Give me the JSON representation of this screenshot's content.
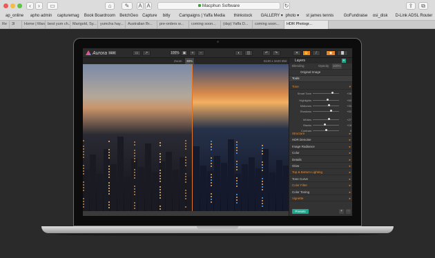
{
  "browser": {
    "url_text": "Macphun Software",
    "favorites": [
      "ap_online",
      "apho admin",
      "capturemag",
      "Book Boardroom",
      "BetchGeo",
      "Capture",
      "bitly",
      "Campaigns | Yaffa Media",
      "thinkstock",
      "GALLERY ▾",
      "photo ▾",
      "st james tennis",
      "GoFundraise",
      "osi_disk",
      "D-Link ADSL Router"
    ],
    "tabs": [
      "Re",
      "3I",
      "Home | Mara",
      "best yum ch...",
      "Marigold, Sy...",
      "yumcha hay...",
      "Australian Br...",
      "pre-orders w...",
      "coming soon...",
      "(dsp) Yaffa D...",
      "coming soon...",
      "HDR Photogr..."
    ],
    "active_tab": "HDR Photogr..."
  },
  "app": {
    "name": "Aurora",
    "badge": "HDR",
    "zoom_label": "Zoom",
    "zoom_value": "38%",
    "image_size": "5130 x 3420",
    "image_bits": "8bit",
    "toolbar": {
      "zoom_pct": "100%"
    },
    "layers": {
      "title": "Layers",
      "blending_label": "Blending",
      "opacity_label": "Opacity",
      "opacity_value": "100%",
      "original_image": "Original Image",
      "tools": "Tools"
    },
    "tone": {
      "title": "Tone",
      "sliders": [
        {
          "label": "Smart Tone",
          "value": "+36"
        },
        {
          "label": "Highlights",
          "value": "+50"
        },
        {
          "label": "Midtones",
          "value": "+30"
        },
        {
          "label": "Shadows",
          "value": "+52"
        },
        {
          "label": "Whites",
          "value": "+27"
        },
        {
          "label": "Blacks",
          "value": "+18"
        },
        {
          "label": "Contrast",
          "value": "0"
        }
      ],
      "slider_levels": [
        0.75,
        0.55,
        0.6,
        0.7,
        0.62,
        0.45,
        0.5
      ]
    },
    "sections": [
      {
        "label": "Structure",
        "orange": true
      },
      {
        "label": "HDR Denoise",
        "orange": false
      },
      {
        "label": "Image Radiance",
        "orange": false
      },
      {
        "label": "Color",
        "orange": false
      },
      {
        "label": "Details",
        "orange": false
      },
      {
        "label": "Glow",
        "orange": false
      },
      {
        "label": "Top & Bottom Lighting",
        "orange": true
      },
      {
        "label": "Tone Curve",
        "orange": false
      },
      {
        "label": "Color Filter",
        "orange": true
      },
      {
        "label": "Color Toning",
        "orange": false
      },
      {
        "label": "Vignette",
        "orange": true
      }
    ],
    "presets_label": "Presets"
  },
  "colors": {
    "accent": "#e88a32",
    "teal": "#1fa58a"
  }
}
